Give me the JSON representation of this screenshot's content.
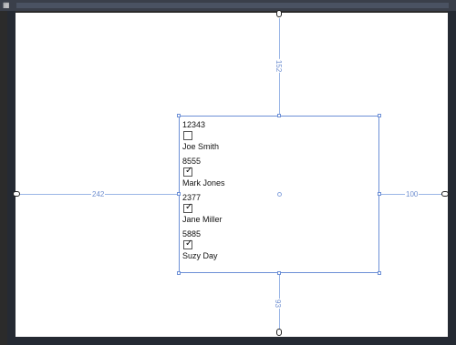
{
  "toolbar": {
    "grid_icon": "grid-icon"
  },
  "margins": {
    "top": "152",
    "left": "242",
    "right": "100",
    "bottom": "93"
  },
  "list": {
    "items": [
      {
        "id": "12343",
        "name": "Joe Smith",
        "checked": false
      },
      {
        "id": "8555",
        "name": "Mark Jones",
        "checked": true
      },
      {
        "id": "2377",
        "name": "Jane Miller",
        "checked": true
      },
      {
        "id": "5885",
        "name": "Suzy Day",
        "checked": true
      }
    ]
  },
  "colors": {
    "selection": "#6c8fd6",
    "guide": "#9ab6e6",
    "frame": "#252a33",
    "canvas": "#ffffff"
  }
}
